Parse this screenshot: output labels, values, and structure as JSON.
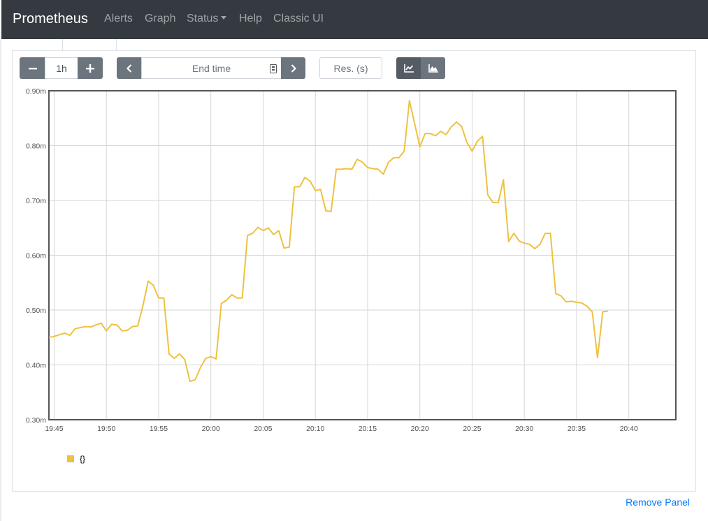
{
  "navbar": {
    "brand": "Prometheus",
    "links": [
      "Alerts",
      "Graph",
      "Status",
      "Help",
      "Classic UI"
    ]
  },
  "controls": {
    "range_minus": "minus-icon",
    "range_value": "1h",
    "range_plus": "plus-icon",
    "end_time_placeholder": "End time",
    "resolution_placeholder": "Res. (s)"
  },
  "legend": {
    "label": "{}"
  },
  "panel": {
    "remove_label": "Remove Panel"
  },
  "colors": {
    "series": "#edc240",
    "navbar": "#343a40",
    "link": "#007bff"
  },
  "chart_data": {
    "type": "line",
    "title": "",
    "xlabel": "",
    "ylabel": "",
    "x_ticks": [
      "19:45",
      "19:50",
      "19:55",
      "20:00",
      "20:05",
      "20:10",
      "20:15",
      "20:20",
      "20:25",
      "20:30",
      "20:35",
      "20:40"
    ],
    "x_range": [
      "19:44:30",
      "20:44:30"
    ],
    "y_ticks": [
      "0.30m",
      "0.40m",
      "0.50m",
      "0.60m",
      "0.70m",
      "0.80m",
      "0.90m"
    ],
    "ylim": [
      0.3,
      0.9
    ],
    "grid": true,
    "legend_position": "bottom-left",
    "series": [
      {
        "name": "{}",
        "color": "#edc240",
        "points": [
          [
            "19:44:30",
            0.45
          ],
          [
            "19:45:00",
            0.452
          ],
          [
            "19:45:30",
            0.455
          ],
          [
            "19:46:00",
            0.458
          ],
          [
            "19:46:30",
            0.454
          ],
          [
            "19:47:00",
            0.466
          ],
          [
            "19:47:30",
            0.468
          ],
          [
            "19:48:00",
            0.47
          ],
          [
            "19:48:30",
            0.469
          ],
          [
            "19:49:00",
            0.473
          ],
          [
            "19:49:30",
            0.476
          ],
          [
            "19:50:00",
            0.462
          ],
          [
            "19:50:30",
            0.474
          ],
          [
            "19:51:00",
            0.473
          ],
          [
            "19:51:30",
            0.462
          ],
          [
            "19:52:00",
            0.463
          ],
          [
            "19:52:30",
            0.47
          ],
          [
            "19:53:00",
            0.471
          ],
          [
            "19:53:30",
            0.508
          ],
          [
            "19:54:00",
            0.553
          ],
          [
            "19:54:30",
            0.545
          ],
          [
            "19:55:00",
            0.522
          ],
          [
            "19:55:30",
            0.522
          ],
          [
            "19:56:00",
            0.42
          ],
          [
            "19:56:30",
            0.412
          ],
          [
            "19:57:00",
            0.42
          ],
          [
            "19:57:30",
            0.41
          ],
          [
            "19:58:00",
            0.37
          ],
          [
            "19:58:30",
            0.373
          ],
          [
            "19:59:00",
            0.395
          ],
          [
            "19:59:30",
            0.412
          ],
          [
            "20:00:00",
            0.415
          ],
          [
            "20:00:30",
            0.411
          ],
          [
            "20:01:00",
            0.512
          ],
          [
            "20:01:30",
            0.518
          ],
          [
            "20:02:00",
            0.528
          ],
          [
            "20:02:30",
            0.522
          ],
          [
            "20:03:00",
            0.522
          ],
          [
            "20:03:30",
            0.636
          ],
          [
            "20:04:00",
            0.64
          ],
          [
            "20:04:30",
            0.651
          ],
          [
            "20:05:00",
            0.645
          ],
          [
            "20:05:30",
            0.65
          ],
          [
            "20:06:00",
            0.638
          ],
          [
            "20:06:30",
            0.645
          ],
          [
            "20:07:00",
            0.613
          ],
          [
            "20:07:30",
            0.615
          ],
          [
            "20:08:00",
            0.725
          ],
          [
            "20:08:30",
            0.725
          ],
          [
            "20:09:00",
            0.742
          ],
          [
            "20:09:30",
            0.735
          ],
          [
            "20:10:00",
            0.718
          ],
          [
            "20:10:30",
            0.72
          ],
          [
            "20:11:00",
            0.681
          ],
          [
            "20:11:30",
            0.68
          ],
          [
            "20:12:00",
            0.757
          ],
          [
            "20:12:30",
            0.757
          ],
          [
            "20:13:00",
            0.758
          ],
          [
            "20:13:30",
            0.757
          ],
          [
            "20:14:00",
            0.775
          ],
          [
            "20:14:30",
            0.77
          ],
          [
            "20:15:00",
            0.76
          ],
          [
            "20:15:30",
            0.758
          ],
          [
            "20:16:00",
            0.757
          ],
          [
            "20:16:30",
            0.748
          ],
          [
            "20:17:00",
            0.77
          ],
          [
            "20:17:30",
            0.778
          ],
          [
            "20:18:00",
            0.778
          ],
          [
            "20:18:30",
            0.79
          ],
          [
            "20:19:00",
            0.882
          ],
          [
            "20:19:30",
            0.84
          ],
          [
            "20:20:00",
            0.798
          ],
          [
            "20:20:30",
            0.822
          ],
          [
            "20:21:00",
            0.822
          ],
          [
            "20:21:30",
            0.818
          ],
          [
            "20:22:00",
            0.826
          ],
          [
            "20:22:30",
            0.82
          ],
          [
            "20:23:00",
            0.834
          ],
          [
            "20:23:30",
            0.843
          ],
          [
            "20:24:00",
            0.835
          ],
          [
            "20:24:30",
            0.806
          ],
          [
            "20:25:00",
            0.79
          ],
          [
            "20:25:30",
            0.808
          ],
          [
            "20:26:00",
            0.817
          ],
          [
            "20:26:30",
            0.71
          ],
          [
            "20:27:00",
            0.696
          ],
          [
            "20:27:30",
            0.696
          ],
          [
            "20:28:00",
            0.738
          ],
          [
            "20:28:30",
            0.625
          ],
          [
            "20:29:00",
            0.64
          ],
          [
            "20:29:30",
            0.626
          ],
          [
            "20:30:00",
            0.622
          ],
          [
            "20:30:30",
            0.62
          ],
          [
            "20:31:00",
            0.612
          ],
          [
            "20:31:30",
            0.62
          ],
          [
            "20:32:00",
            0.64
          ],
          [
            "20:32:30",
            0.64
          ],
          [
            "20:33:00",
            0.53
          ],
          [
            "20:33:30",
            0.526
          ],
          [
            "20:34:00",
            0.515
          ],
          [
            "20:34:30",
            0.516
          ],
          [
            "20:35:00",
            0.514
          ],
          [
            "20:35:30",
            0.513
          ],
          [
            "20:36:00",
            0.507
          ],
          [
            "20:36:30",
            0.497
          ],
          [
            "20:37:00",
            0.413
          ],
          [
            "20:37:30",
            0.497
          ],
          [
            "20:38:00",
            0.498
          ]
        ]
      }
    ]
  }
}
